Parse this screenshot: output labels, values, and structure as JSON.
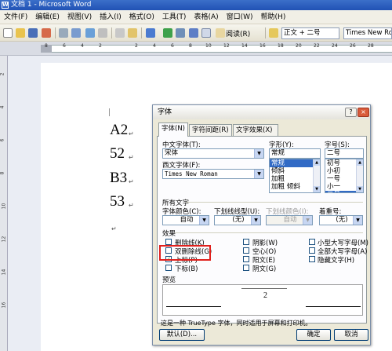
{
  "window": {
    "title": "文档 1 - Microsoft Word"
  },
  "menubar": {
    "items": [
      "文件(F)",
      "编辑(E)",
      "视图(V)",
      "插入(I)",
      "格式(O)",
      "工具(T)",
      "表格(A)",
      "窗口(W)",
      "帮助(H)"
    ]
  },
  "toolbar": {
    "read_label": "阅读(R)",
    "style_value": "正文 + 二号",
    "font_value": "Times New Ro"
  },
  "ruler": {
    "h_numbers": [
      "8",
      "6",
      "4",
      "2",
      "2",
      "4",
      "6",
      "8",
      "10",
      "12",
      "14",
      "16",
      "18",
      "20",
      "22",
      "24",
      "26",
      "28"
    ],
    "v_numbers": [
      "2",
      "4",
      "6",
      "8",
      "10",
      "12",
      "14",
      "16"
    ]
  },
  "document": {
    "lines": [
      "A2",
      "52",
      "B3",
      "53"
    ],
    "para_mark": "↵"
  },
  "dialog": {
    "title": "字体",
    "help_btn": "?",
    "close_btn": "×",
    "tabs": [
      "字体(N)",
      "字符间距(R)",
      "文字效果(X)"
    ],
    "cn_font_label": "中文字体(T):",
    "cn_font_value": "宋体",
    "west_font_label": "西文字体(F):",
    "west_font_value": "Times New Roman",
    "style_label": "字形(Y):",
    "style_value": "常规",
    "style_options": [
      "常规",
      "倾斜",
      "加粗",
      "加粗 倾斜"
    ],
    "size_label": "字号(S):",
    "size_value": "二号",
    "size_options": [
      "初号",
      "小初",
      "一号",
      "小一",
      "二号"
    ],
    "all_text_label": "所有文字",
    "font_color_label": "字体颜色(C):",
    "font_color_value": "自动",
    "underline_label": "下划线线型(U):",
    "underline_value": "(无)",
    "underline_color_label": "下划线颜色(I):",
    "underline_color_value": "自动",
    "emphasis_label": "着重号:",
    "emphasis_value": "(无)",
    "effects_label": "效果",
    "effects": [
      {
        "label": "删除线(K)",
        "checked": false
      },
      {
        "label": "双删除线(G)",
        "checked": false
      },
      {
        "label": "上标(P)",
        "checked": true
      },
      {
        "label": "下标(B)",
        "checked": false
      },
      {
        "label": "阴影(W)",
        "checked": false
      },
      {
        "label": "空心(O)",
        "checked": false
      },
      {
        "label": "阳文(E)",
        "checked": false
      },
      {
        "label": "阴文(G)",
        "checked": false
      },
      {
        "label": "小型大写字母(M)",
        "checked": false
      },
      {
        "label": "全部大写字母(A)",
        "checked": false
      },
      {
        "label": "隐藏文字(H)",
        "checked": false
      }
    ],
    "check_mark": "✓",
    "preview_label": "预览",
    "preview_text": "2",
    "info_text": "这是一种 TrueType 字体，同时适用于屏幕和打印机。",
    "default_btn": "默认(D)...",
    "ok_btn": "确定",
    "cancel_btn": "取消"
  },
  "colors": {
    "title_bar": "#2152b5",
    "selection": "#316ac5",
    "highlight_box": "#e0201c",
    "checkbox_check": "#21a121"
  }
}
